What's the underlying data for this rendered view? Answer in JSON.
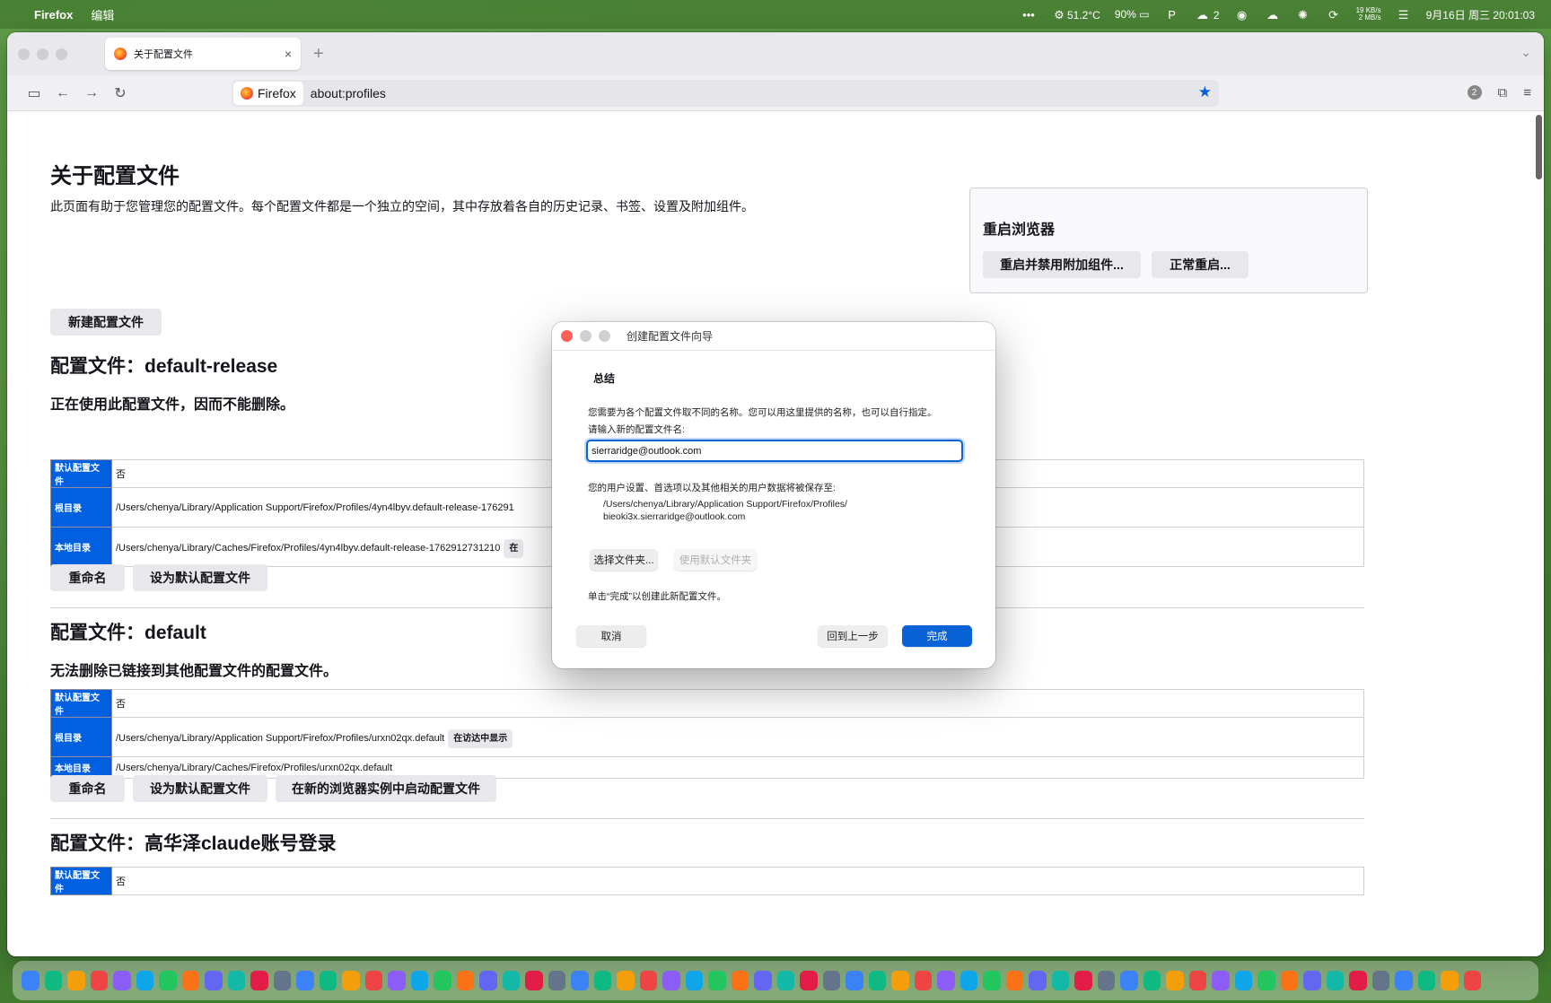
{
  "menubar": {
    "app": "Firefox",
    "menu": "编辑",
    "temp": "51.2°C",
    "battery": "90%",
    "wechat_count": "2",
    "net_up": "19 KB/s",
    "net_down": "2 MB/s",
    "datetime": "9月16日 周三 20:01:03"
  },
  "tab": {
    "title": "关于配置文件"
  },
  "urlbar": {
    "identity": "Firefox",
    "url": "about:profiles"
  },
  "nav": {
    "badge": "2"
  },
  "page": {
    "title": "关于配置文件",
    "description": "此页面有助于您管理您的配置文件。每个配置文件都是一个独立的空间，其中存放着各自的历史记录、书签、设置及附加组件。",
    "restart_title": "重启浏览器",
    "restart_safe": "重启并禁用附加组件...",
    "restart_normal": "正常重启...",
    "new_profile": "新建配置文件"
  },
  "labels": {
    "default_profile": "默认配置文件",
    "root_dir": "根目录",
    "local_dir": "本地目录",
    "rename": "重命名",
    "set_default": "设为默认配置文件",
    "launch_new": "在新的浏览器实例中启动配置文件",
    "show_in_finder": "在访达中显示",
    "no": "否"
  },
  "profiles": [
    {
      "heading": "配置文件：default-release",
      "note": "正在使用此配置文件，因而不能删除。",
      "is_default": "否",
      "root": "/Users/chenya/Library/Application Support/Firefox/Profiles/4yn4lbyv.default-release-176291",
      "local": "/Users/chenya/Library/Caches/Firefox/Profiles/4yn4lbyv.default-release-1762912731210",
      "local_btn": "在"
    },
    {
      "heading": "配置文件：default",
      "note": "无法删除已链接到其他配置文件的配置文件。",
      "is_default": "否",
      "root": "/Users/chenya/Library/Application Support/Firefox/Profiles/urxn02qx.default",
      "local": "/Users/chenya/Library/Caches/Firefox/Profiles/urxn02qx.default"
    },
    {
      "heading": "配置文件：高华泽claude账号登录",
      "is_default": "否"
    }
  ],
  "dialog": {
    "title": "创建配置文件向导",
    "heading": "总结",
    "intro": "您需要为各个配置文件取不同的名称。您可以用这里提供的名称，也可以自行指定。",
    "input_label": "请输入新的配置文件名:",
    "input_value": "sierraridge@outlook.com",
    "save_label": "您的用户设置、首选项以及其他相关的用户数据将被保存至:",
    "path_line1": "/Users/chenya/Library/Application Support/Firefox/Profiles/",
    "path_line2": "bieoki3x.sierraridge@outlook.com",
    "choose_folder": "选择文件夹...",
    "use_default_folder": "使用默认文件夹",
    "finish_hint": "单击“完成”以创建此新配置文件。",
    "cancel": "取消",
    "back": "回到上一步",
    "finish": "完成"
  },
  "colors": {
    "accent": "#0060df",
    "dialog_primary": "#0a63d6",
    "close_red": "#ff5f57"
  }
}
